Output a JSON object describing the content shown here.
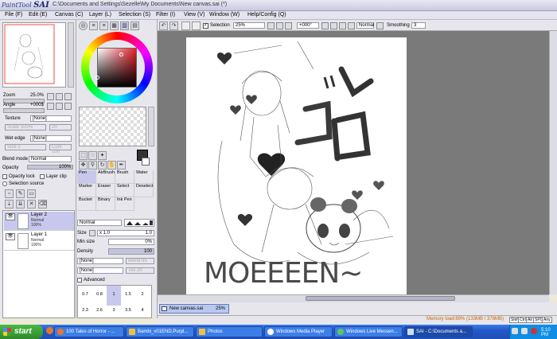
{
  "window": {
    "logo_prefix": "PaintTool",
    "logo_name": "SAI",
    "title": "C:\\Documents and Settings\\Sezelle\\My Documents\\New canvas.sai (*)"
  },
  "menu": [
    "File (F)",
    "Edit (E)",
    "Canvas (C)",
    "Layer (L)",
    "Selection (S)",
    "Filter (I)",
    "View (V)",
    "Window (W)",
    "Help/Config (Q)"
  ],
  "navigator": {
    "zoom_label": "Zoom",
    "zoom_value": "25.0%",
    "angle_label": "Angle",
    "angle_value": "+000$"
  },
  "layer_props": {
    "texture_label": "Texture",
    "texture_value": "[None]",
    "texture_scale": "Scale",
    "texture_scale_val": "100%",
    "texture_str": "20",
    "wet_edge_label": "Wet edge",
    "wet_edge_value": "[None]",
    "wet_size": "Size",
    "wet_size_val": "1",
    "wet_cont": "Cont",
    "wet_cont_val": "100",
    "blend_label": "Blend mode",
    "blend_value": "Normal",
    "opacity_label": "Opacity",
    "opacity_value": "100%",
    "opacity_lock": "Opacity lock",
    "layer_clip": "Layer clip",
    "selection_source": "Selection source"
  },
  "layers": [
    {
      "name": "Layer 2",
      "mode": "Normal",
      "opacity": "100%",
      "active": true
    },
    {
      "name": "Layer 1",
      "mode": "Normal",
      "opacity": "100%",
      "active": false
    }
  ],
  "tools": [
    [
      "Pen",
      "AirBrush",
      "Brush",
      "Water"
    ],
    [
      "Marker",
      "Eraser",
      "Select",
      "Deselect"
    ],
    [
      "Bucket",
      "Binary",
      "Ink Pen",
      ""
    ]
  ],
  "brush": {
    "mode": "Normal",
    "size_label": "Size",
    "size_mult": "x 1.0",
    "size_value": "1.0",
    "min_size_label": "Min size",
    "min_size_value": "0%",
    "density_label": "Density",
    "density_value": "100",
    "shape1": "[None]",
    "shape1_val": "95",
    "shape1_extra": "Blend",
    "shape2": "[None]",
    "shape2_val": "20",
    "shape2_extra": "Tex",
    "advanced": "Advanced",
    "sizes_row1": [
      "0.7",
      "0.8",
      "1",
      "1.5",
      "2"
    ],
    "sizes_row2": [
      "2.3",
      "2.6",
      "3",
      "3.5",
      "4"
    ]
  },
  "canvas_toolbar": {
    "selection_label": "Selection",
    "zoom": "25%",
    "angle": "+000°",
    "mode": "Normal",
    "smoothing_label": "Smoothing",
    "smoothing_value": "3"
  },
  "artwork_text": "MOEEEEN~",
  "doc_tab": {
    "name": "New canvas.sai",
    "zoom": "25%"
  },
  "status": {
    "memory": "Memory load:89% (133MB / 378MB)",
    "keys": [
      "Shift",
      "Ctrl",
      "Alt",
      "SPC",
      "Any"
    ]
  },
  "taskbar": {
    "start": "start",
    "tasks": [
      "100 Tales of Horror - ...",
      "Bambi_v01END.Purpl...",
      "Photos",
      "Windows Media Player",
      "Windows Live Messen...",
      "SAI - C:\\Documents a..."
    ],
    "clock": "5:10 PM"
  }
}
